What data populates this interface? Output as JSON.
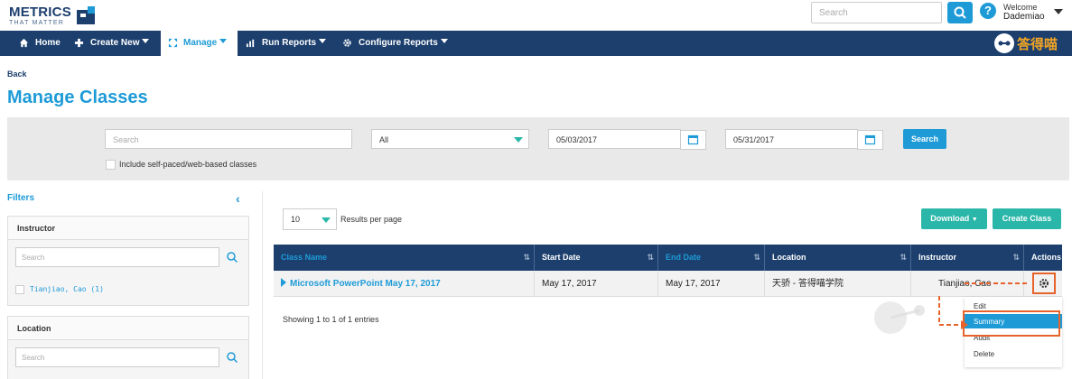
{
  "header": {
    "logo_line1": "METRICS",
    "logo_line2": "THAT MATTER",
    "search_placeholder": "Search",
    "welcome_label": "Welcome",
    "user_name": "Dademiao"
  },
  "nav": {
    "items": [
      {
        "label": "Home",
        "icon": "home-icon"
      },
      {
        "label": "Create New",
        "icon": "plus-icon"
      },
      {
        "label": "Manage",
        "icon": "arrows-icon"
      },
      {
        "label": "Run Reports",
        "icon": "chart-icon"
      },
      {
        "label": "Configure Reports",
        "icon": "gear-icon"
      }
    ],
    "brand_text": "答得喵"
  },
  "page": {
    "back_label": "Back",
    "title": "Manage Classes"
  },
  "filter_bar": {
    "search_placeholder": "Search",
    "select_value": "All",
    "start_date": "05/03/2017",
    "end_date": "05/31/2017",
    "search_button": "Search",
    "checkbox_label": "Include self-paced/web-based classes"
  },
  "sidebar": {
    "filters_title": "Filters",
    "panels": [
      {
        "title": "Instructor",
        "search_placeholder": "Search",
        "options": [
          "Tianjiao, Cao (1)"
        ]
      },
      {
        "title": "Location",
        "search_placeholder": "Search",
        "options": []
      }
    ]
  },
  "table": {
    "results_per_page": "10",
    "results_label": "Results per page",
    "download_button": "Download",
    "create_class_button": "Create Class",
    "columns": [
      "Class Name",
      "Start Date",
      "End Date",
      "Location",
      "Instructor",
      "Actions"
    ],
    "rows": [
      {
        "class_name": "Microsoft PowerPoint May 17, 2017",
        "start_date": "May 17, 2017",
        "end_date": "May 17, 2017",
        "location": "天骄 - 答得喵学院",
        "instructor": "Tianjiao, Cao"
      }
    ],
    "showing_text": "Showing 1 to 1 of 1 entries",
    "actions_menu": [
      "Edit",
      "Summary",
      "Audit",
      "Delete"
    ],
    "highlighted_action": "Summary"
  },
  "colors": {
    "navy": "#1c3f6e",
    "accent_blue": "#1e9bd7",
    "teal": "#2ab7a9",
    "annotation_orange": "#e8632b"
  }
}
